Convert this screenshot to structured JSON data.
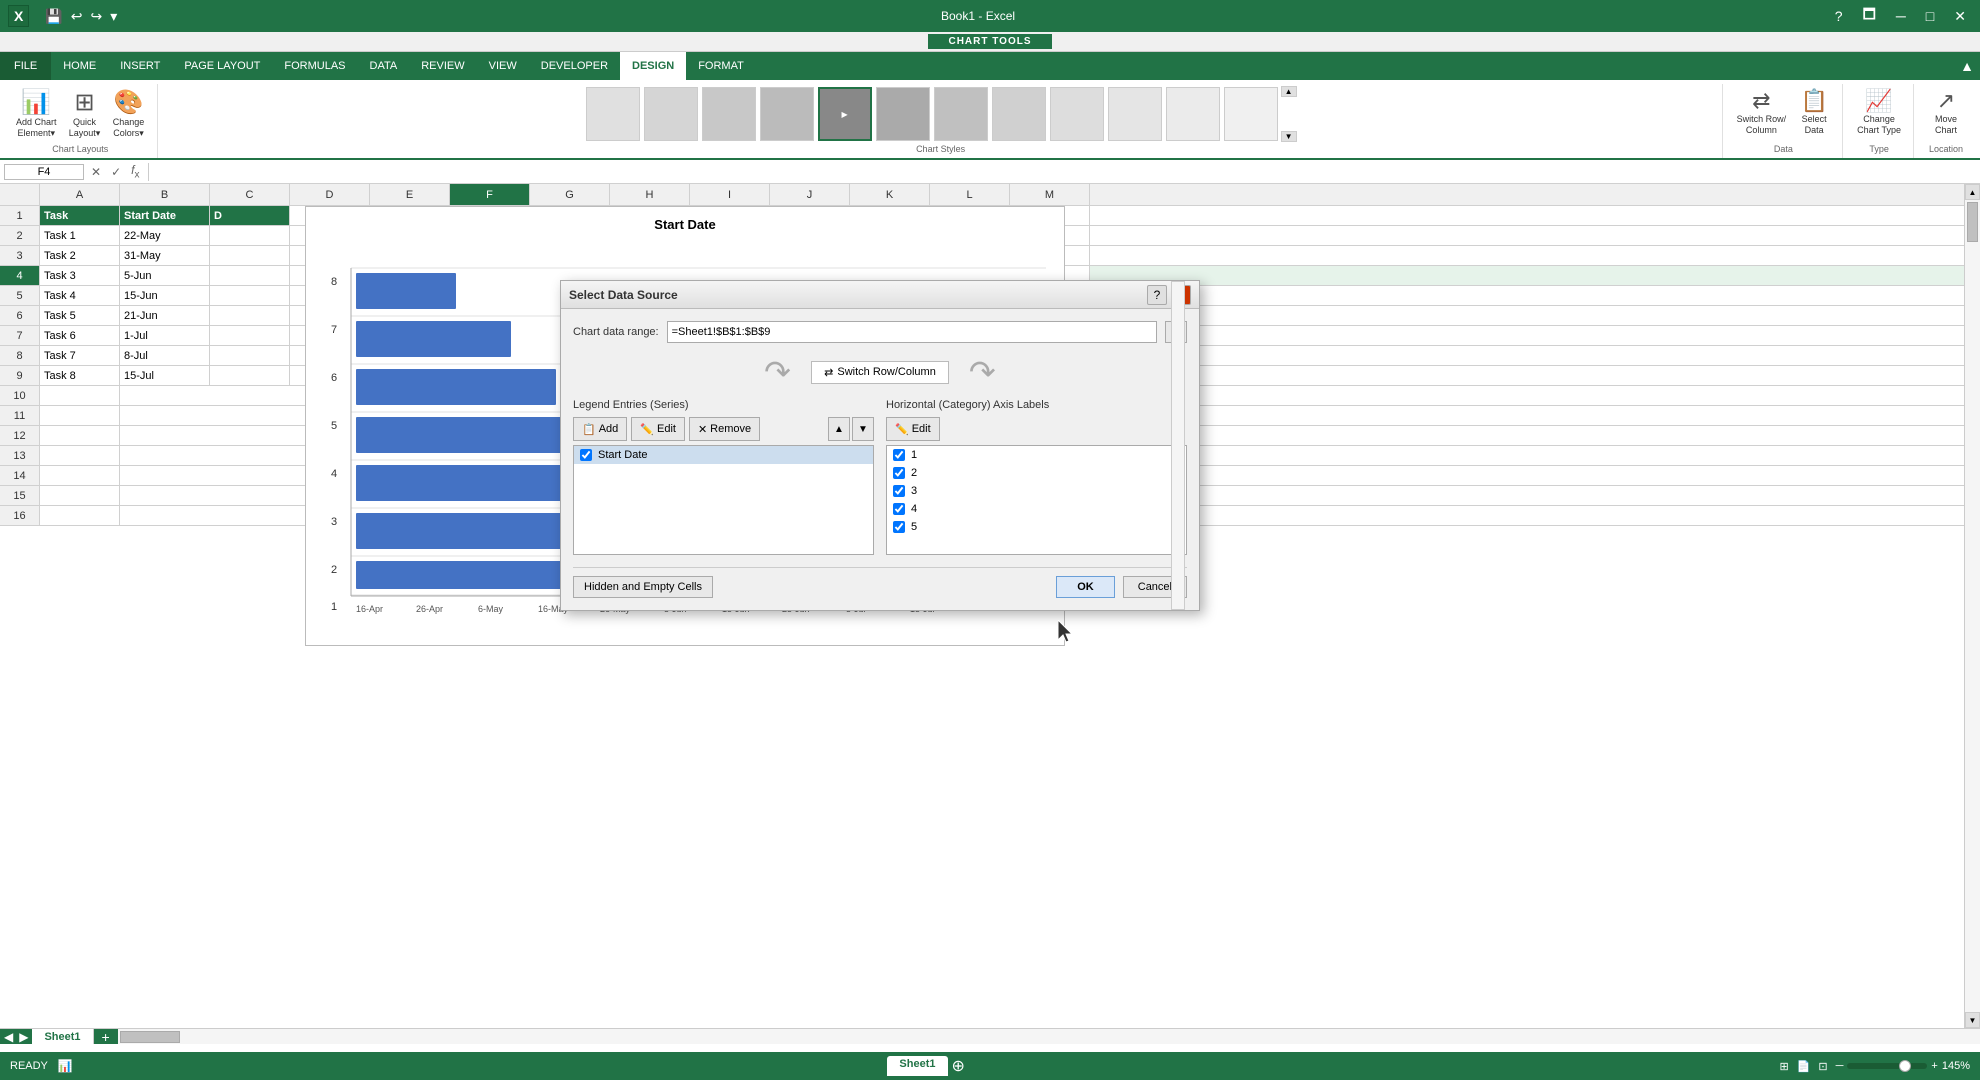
{
  "app": {
    "title": "Book1 - Excel",
    "chart_tools_label": "CHART TOOLS"
  },
  "ribbon": {
    "tabs": [
      "FILE",
      "HOME",
      "INSERT",
      "PAGE LAYOUT",
      "FORMULAS",
      "DATA",
      "REVIEW",
      "VIEW",
      "DEVELOPER",
      "DESIGN",
      "FORMAT"
    ],
    "active_tab": "DESIGN",
    "groups": {
      "chart_layouts": {
        "label": "Chart Layouts",
        "buttons": [
          {
            "label": "Add Chart\nElement",
            "icon": "📊"
          },
          {
            "label": "Quick\nLayout",
            "icon": "⊞"
          },
          {
            "label": "Change\nColors",
            "icon": "🎨"
          }
        ]
      },
      "chart_styles": {
        "label": "Chart Styles"
      },
      "data": {
        "label": "Data",
        "buttons": [
          {
            "label": "Switch Row/\nColumn",
            "icon": "⇄"
          },
          {
            "label": "Select\nData",
            "icon": "📋"
          }
        ]
      },
      "type": {
        "label": "Type",
        "buttons": [
          {
            "label": "Change\nChart Type",
            "icon": "📈"
          }
        ]
      },
      "location": {
        "label": "Location",
        "buttons": [
          {
            "label": "Move\nChart",
            "icon": "↗"
          }
        ]
      }
    }
  },
  "formula_bar": {
    "cell_ref": "F4",
    "formula": ""
  },
  "columns": [
    "A",
    "B",
    "C",
    "D",
    "E",
    "F",
    "G",
    "H",
    "I",
    "J",
    "K",
    "L",
    "M"
  ],
  "active_col": "F",
  "rows": [
    1,
    2,
    3,
    4,
    5,
    6,
    7,
    8,
    9,
    10,
    11,
    12,
    13,
    14,
    15,
    16
  ],
  "active_row": 4,
  "cells": {
    "A1": {
      "value": "Task",
      "style": "header"
    },
    "B1": {
      "value": "Start Date",
      "style": "header"
    },
    "C1": {
      "value": "D",
      "style": "header"
    },
    "A2": {
      "value": "Task 1"
    },
    "B2": {
      "value": "22-May"
    },
    "A3": {
      "value": "Task 2"
    },
    "B3": {
      "value": "31-May"
    },
    "A4": {
      "value": "Task 3"
    },
    "B4": {
      "value": "5-Jun"
    },
    "A5": {
      "value": "Task 4"
    },
    "B5": {
      "value": "15-Jun"
    },
    "A6": {
      "value": "Task 5"
    },
    "B6": {
      "value": "21-Jun"
    },
    "A7": {
      "value": "Task 6"
    },
    "B7": {
      "value": "1-Jul"
    },
    "A8": {
      "value": "Task 7"
    },
    "B8": {
      "value": "8-Jul"
    },
    "A9": {
      "value": "Task 8"
    },
    "B9": {
      "value": "15-Jul"
    }
  },
  "chart": {
    "title": "Start Date",
    "x_labels": [
      "16-Apr",
      "26-Apr",
      "6-May",
      "16-May",
      "26-May",
      "5-Jun",
      "15-Jun",
      "25-Jun",
      "5-Jul",
      "15-Jul"
    ],
    "y_labels": [
      "1",
      "2",
      "3",
      "4",
      "5",
      "6",
      "7",
      "8"
    ],
    "bar_color": "#4472c4"
  },
  "dialog": {
    "title": "Select Data Source",
    "chart_data_range_label": "Chart data range:",
    "chart_data_range_value": "=Sheet1!$B$1:$B$9",
    "switch_row_column_label": "Switch Row/Column",
    "legend_entries_label": "Legend Entries (Series)",
    "horizontal_axis_label": "Horizontal (Category) Axis Labels",
    "series_add": "Add",
    "series_edit": "Edit",
    "series_remove": "Remove",
    "axis_edit": "Edit",
    "series_items": [
      {
        "label": "Start Date",
        "checked": true
      }
    ],
    "axis_items": [
      {
        "label": "1",
        "checked": true
      },
      {
        "label": "2",
        "checked": true
      },
      {
        "label": "3",
        "checked": true
      },
      {
        "label": "4",
        "checked": true
      },
      {
        "label": "5",
        "checked": true
      }
    ],
    "hidden_cells_btn": "Hidden and Empty Cells",
    "ok_btn": "OK",
    "cancel_btn": "Cancel"
  },
  "status_bar": {
    "ready": "READY",
    "sheet_tab": "Sheet1",
    "zoom": "145%"
  }
}
